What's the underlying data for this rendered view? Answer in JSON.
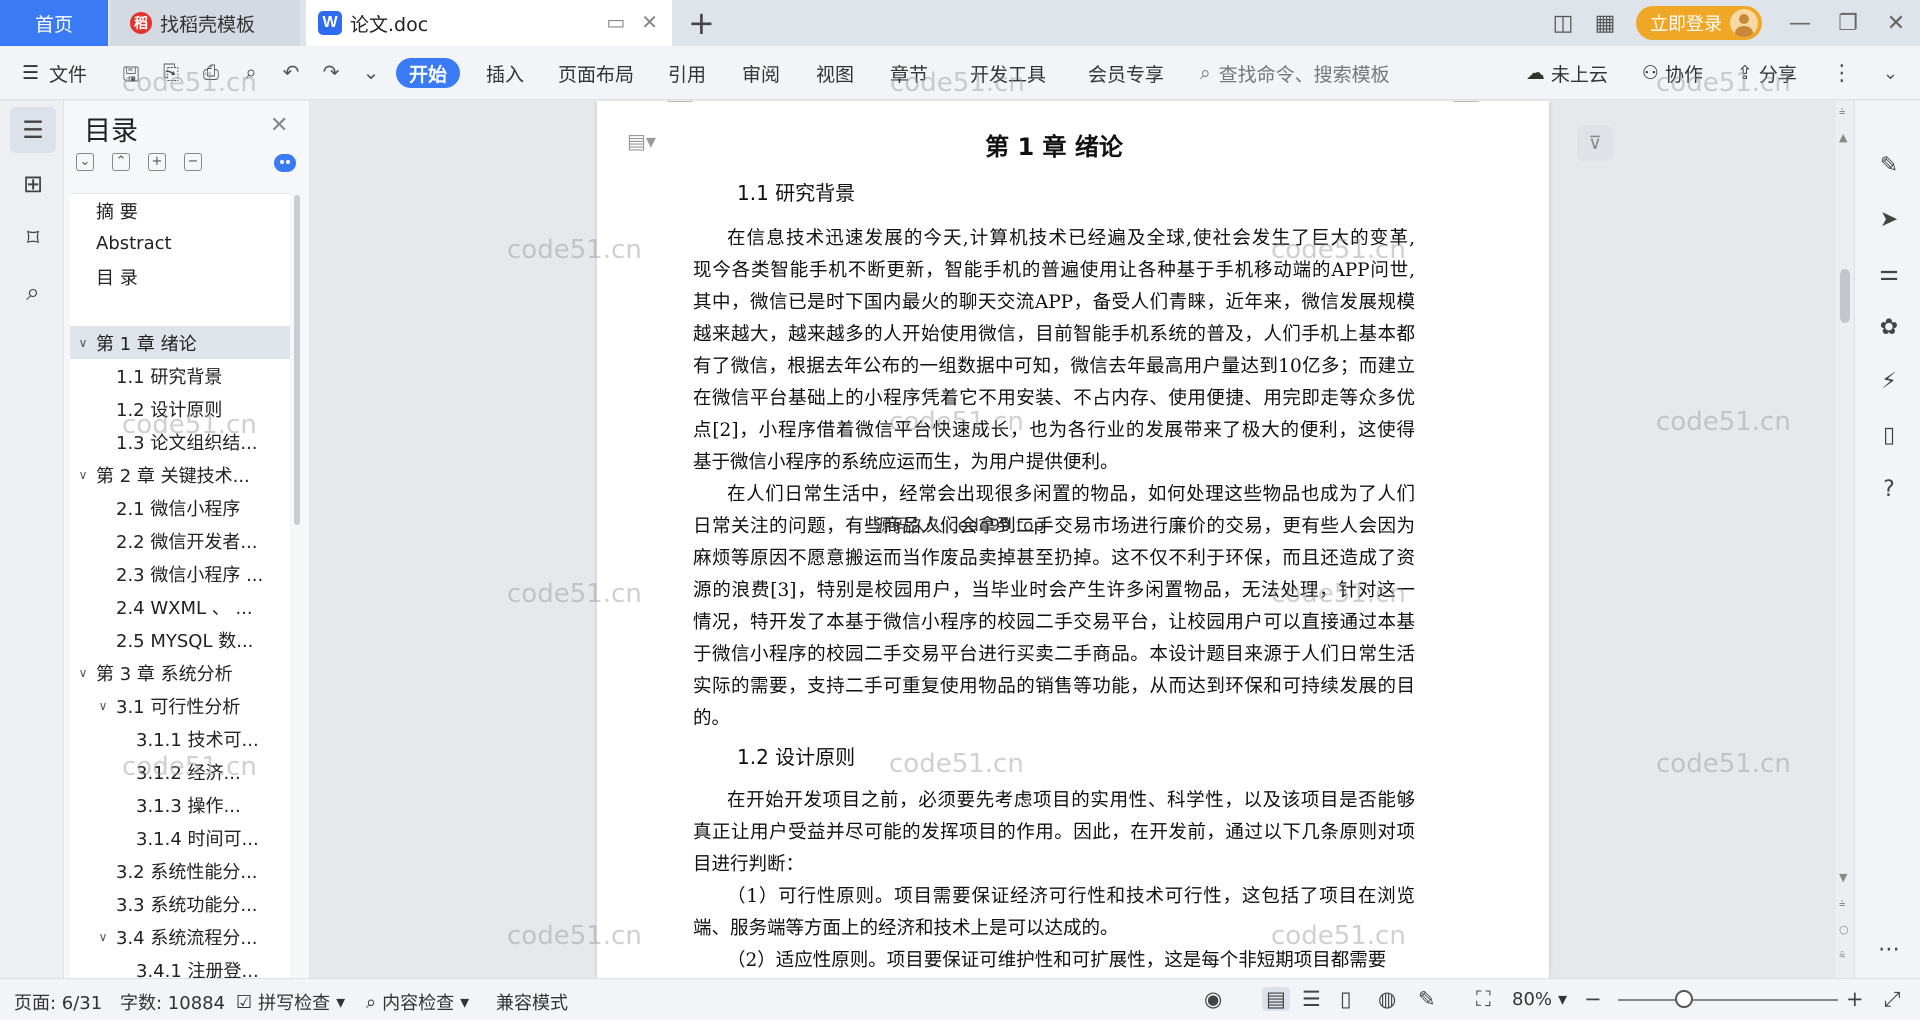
{
  "tabs": {
    "home": "首页",
    "templates": "找稻壳模板",
    "document": "论文.doc",
    "new_tab": "+"
  },
  "titlebar": {
    "login": "立即登录"
  },
  "ribbon": {
    "file_menu": "文件",
    "menus": [
      "开始",
      "插入",
      "页面布局",
      "引用",
      "审阅",
      "视图",
      "章节",
      "开发工具",
      "会员专享"
    ],
    "search_placeholder": "查找命令、搜索模板",
    "cloud": "未上云",
    "collab": "协作",
    "share": "分享"
  },
  "toc": {
    "title": "目录",
    "items": [
      {
        "label": "摘  要",
        "level": 0,
        "arrow": ""
      },
      {
        "label": "Abstract",
        "level": 0,
        "arrow": ""
      },
      {
        "label": "目    录",
        "level": 0,
        "arrow": ""
      },
      {
        "label": "",
        "level": 0,
        "arrow": "",
        "spacer": true
      },
      {
        "label": "第 1 章    绪论",
        "level": 0,
        "arrow": "v",
        "selected": true
      },
      {
        "label": "1.1 研究背景",
        "level": 1,
        "arrow": ""
      },
      {
        "label": "1.2 设计原则",
        "level": 1,
        "arrow": ""
      },
      {
        "label": "1.3 论文组织结...",
        "level": 1,
        "arrow": ""
      },
      {
        "label": "第 2 章    关键技术...",
        "level": 0,
        "arrow": "v"
      },
      {
        "label": "2.1  微信小程序",
        "level": 1,
        "arrow": ""
      },
      {
        "label": "2.2  微信开发者...",
        "level": 1,
        "arrow": ""
      },
      {
        "label": "2.3 微信小程序 ...",
        "level": 1,
        "arrow": ""
      },
      {
        "label": "2.4 WXML  、 ...",
        "level": 1,
        "arrow": ""
      },
      {
        "label": "2.5 MYSQL 数...",
        "level": 1,
        "arrow": ""
      },
      {
        "label": "第 3 章    系统分析",
        "level": 0,
        "arrow": "v"
      },
      {
        "label": "3.1  可行性分析",
        "level": 1,
        "arrow": "v"
      },
      {
        "label": "3.1.1  技术可...",
        "level": 2,
        "arrow": ""
      },
      {
        "label": "3.1.2  经济...",
        "level": 2,
        "arrow": ""
      },
      {
        "label": "3.1.3   操作...",
        "level": 2,
        "arrow": ""
      },
      {
        "label": "3.1.4 时间可...",
        "level": 2,
        "arrow": ""
      },
      {
        "label": "3.2  系统性能分...",
        "level": 1,
        "arrow": ""
      },
      {
        "label": "3.3  系统功能分...",
        "level": 1,
        "arrow": ""
      },
      {
        "label": "3.4  系统流程分...",
        "level": 1,
        "arrow": "v"
      },
      {
        "label": "3.4.1 注册登...",
        "level": 2,
        "arrow": ""
      }
    ]
  },
  "document": {
    "chapter_title": "第 1 章    绪论",
    "section1_title": "1.1 研究背景",
    "section1_para1": [
      "在信息技术迅速发展的今天,计算机技术已经遍及全球,使社会发生了巨大的变革,",
      "现今各类智能手机不断更新，智能手机的普遍使用让各种基于手机移动端的APP问世,",
      "其中，微信已是时下国内最火的聊天交流APP，备受人们青睐，近年来，微信发展规模",
      "越来越大，越来越多的人开始使用微信，目前智能手机系统的普及，人们手机上基本都",
      "有了微信，根据去年公布的一组数据中可知，微信去年最高用户量达到10亿多；而建立",
      "在微信平台基础上的小程序凭着它不用安装、不占内存、使用便捷、用完即走等众多优",
      "点[2]，小程序借着微信平台快速成长，也为各行业的发展带来了极大的便利，这使得",
      "基于微信小程序的系统应运而生，为用户提供便利。"
    ],
    "section1_para2": [
      "在人们日常生活中，经常会出现很多闲置的物品，如何处理这些物品也成为了人们",
      "日常关注的问题，有些商品人们会拿到二手交易市场进行廉价的交易，更有些人会因为",
      "麻烦等原因不愿意搬运而当作废品卖掉甚至扔掉。这不仅不利于环保，而且还造成了资",
      "源的浪费[3]，特别是校园用户，当毕业时会产生许多闲置物品，无法处理，针对这一",
      "情况，特开发了本基于微信小程序的校园二手交易平台，让校园用户可以直接通过本基",
      "于微信小程序的校园二手交易平台进行买卖二手商品。本设计题目来源于人们日常生活",
      "实际的需要，支持二手可重复使用物品的销售等功能，从而达到环保和可持续发展的目",
      "的。"
    ],
    "section2_title": "1.2 设计原则",
    "section2_para1": [
      "在开始开发项目之前，必须要先考虑项目的实用性、科学性，以及该项目是否能够",
      "真正让用户受益并尽可能的发挥项目的作用。因此，在开发前，通过以下几条原则对项",
      "目进行判断："
    ],
    "section2_para2": [
      "（1）可行性原则。项目需要保证经济可行性和技术可行性，这包括了项目在浏览",
      "端、服务端等方面上的经济和技术上是可以达成的。"
    ],
    "section2_para3": [
      "（2）适应性原则。项目要保证可维护性和可扩展性，这是每个非短期项目都需要"
    ]
  },
  "watermarks": {
    "text": "code51.cn",
    "center_text": "源码久久 code99.top"
  },
  "status": {
    "page": "页面: 6/31",
    "words": "字数: 10884",
    "spell": "拼写检查",
    "content": "内容检查",
    "compat": "兼容模式",
    "zoom": "80%",
    "zoom_level": 0.3
  }
}
